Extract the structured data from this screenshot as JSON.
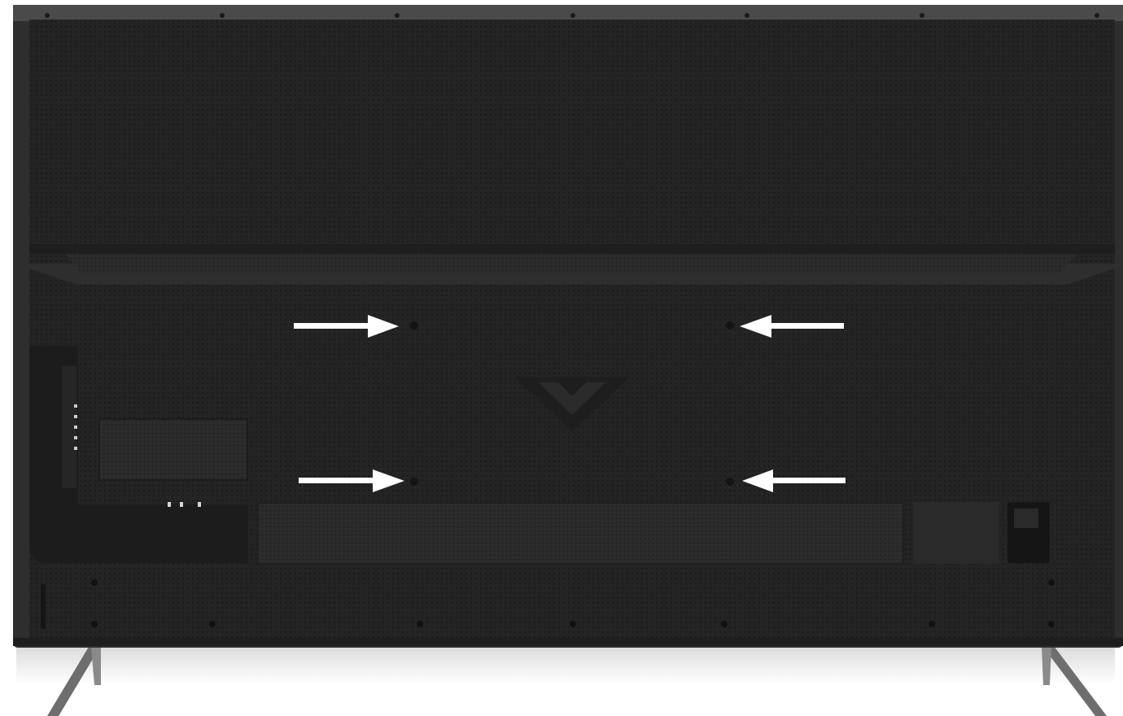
{
  "scene": {
    "subject": "TV rear panel",
    "colors": {
      "background": "#ffffff",
      "panel": "#262626",
      "panel_dark": "#1b1b1b",
      "edge": "#3a3a3a",
      "arrow": "#ffffff",
      "leg": "#6e6e6e"
    },
    "vesa_mount_points": 4,
    "arrow_directions": [
      "right",
      "left",
      "right",
      "left"
    ]
  }
}
